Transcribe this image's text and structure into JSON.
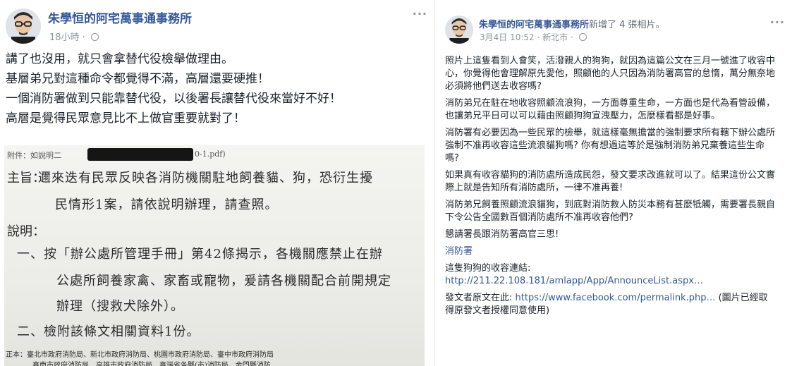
{
  "left_post": {
    "author": "朱學恒的阿宅萬事通事務所",
    "time": "18小時 · ",
    "privacy_icon": "globe-icon",
    "more_icon": "more-options-icon",
    "more_text": "···",
    "paragraphs": [
      "講了也沒用，就只會拿替代役檢舉做理由。",
      "基層弟兄對這種命令都覺得不滿，高層還要硬推！",
      "一個消防署做到只能靠替代役，以後署長讓替代役來當好不好！",
      "高層是覺得民眾意見比不上做官重要就對了！"
    ],
    "document": {
      "attach_prefix": "附件：如說明二",
      "attach_suffix": "0-1.pdf)",
      "subject_label": "主旨：",
      "subject_line1": "邇來迭有民眾反映各消防機關駐地飼養貓、狗，恐衍生擾",
      "subject_line2": "民情形1案，請依說明辦理，請查照。",
      "explanation_label": "說明：",
      "item1_line1": "一、按「辦公處所管理手冊」第42條揭示，各機關應禁止在辦",
      "item1_line2": "公處所飼養家禽、家畜或寵物，爰請各機關配合前開規定",
      "item1_line3": "辦理（搜救犬除外）。",
      "item2": "二、檢附該條文相關資料1份。",
      "cc_line1": "正本：臺北市政府消防局、新北市政府消防局、桃園市政府消防局、臺中市政府消防局",
      "cc_line2": "臺南市政府消防局、高雄市政府消防局、臺灣省各縣(市)消防局、金門縣消防"
    }
  },
  "right_post": {
    "author": "朱學恒的阿宅萬事通事務所",
    "action": "新增了 4 張相片。",
    "time": "3月4日 10:52 · 新北市 · ",
    "privacy_icon": "globe-icon",
    "more_icon": "more-options-icon",
    "more_text": "···",
    "paragraphs": [
      "照片上這隻看到人會笑，活潑親人的狗狗，就因為這篇公文在三月一號進了收容中心，你覺得他會理解原先愛他，照顧他的人只因為消防署高官的怠惰，萬分無奈地必須將他們送去收容嗎?",
      "消防弟兄在駐在地收容照顧流浪狗，一方面尊重生命，一方面也是代為看管設備，也讓弟兄平日可以可以藉由照顧狗狗宣洩壓力，怎麼樣看都是好事。",
      "消防署有必要因為一些民眾的檢舉，就這樣毫無擔當的強制要求所有轄下辦公處所強制不准再收容這些流浪貓狗嗎? 你有想過這等於是強制消防弟兄棄養這些生命嗎?",
      "如果真有收容貓狗的消防處所造成民怨，發文要求改進就可以了。結果這份公文實際上就是告知所有消防處所，一律不准再養!",
      "消防弟兄飼養照顧流浪貓狗，到底對消防救人防災本務有甚麼牴觸，需要署長親自下令公告全國數百個消防處所不准再收容他們?",
      "懇請署長跟消防署高官三思!"
    ],
    "tag": "消防署",
    "link_intro": "這隻狗狗的收容連結:",
    "link_url": "http://211.22.108.181/amlapp/App/AnnounceList.aspx…",
    "source_prefix": "發文者原文在此: ",
    "source_url": "https://www.facebook.com/permalink.php…",
    "source_suffix": " (圖片已經取得原發文者授權同意使用)"
  }
}
